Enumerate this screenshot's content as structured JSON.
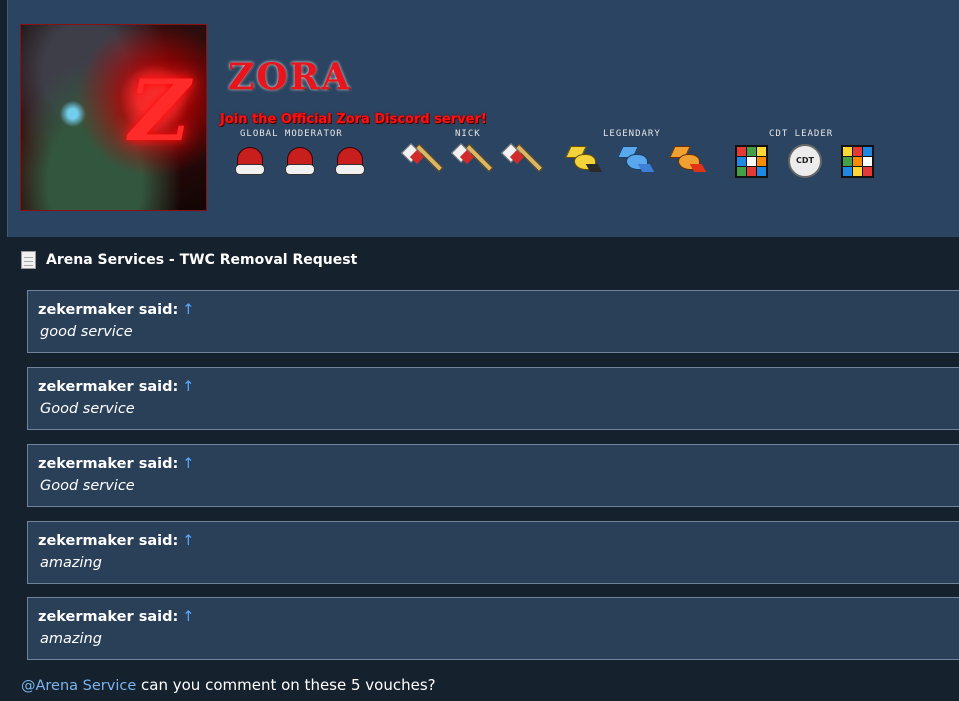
{
  "signature": {
    "logo_text": "ZORA",
    "discord_text": "Join the Official Zora Discord server!",
    "avatar_letter": "Z",
    "ranks": [
      {
        "label": "GLOBAL MODERATOR",
        "icon": "santa-hat-icon"
      },
      {
        "label": "NICK",
        "icon": "spear-icon"
      },
      {
        "label": "LEGENDARY",
        "icon": "legendary-bird-icon"
      },
      {
        "label": "CDT LEADER",
        "icon": "rubiks-cube-icon"
      }
    ],
    "cdt_badge_text": "CDT"
  },
  "thread": {
    "title": "Arena Services - TWC Removal Request"
  },
  "quotes": [
    {
      "author": "zekermaker said:",
      "arrow": "↑",
      "text": "good service"
    },
    {
      "author": "zekermaker said:",
      "arrow": "↑",
      "text": "Good service"
    },
    {
      "author": "zekermaker said:",
      "arrow": "↑",
      "text": "Good service"
    },
    {
      "author": "zekermaker said:",
      "arrow": "↑",
      "text": "amazing"
    },
    {
      "author": "zekermaker said:",
      "arrow": "↑",
      "text": "amazing"
    }
  ],
  "reply": {
    "mention": "@Arena Service",
    "text": " can you comment on these 5 vouches?"
  },
  "colors": {
    "banner_bg": "#2a4461",
    "page_bg": "#16212e",
    "quote_bg": "#2a4059",
    "quote_border": "#6f8399",
    "link": "#7ab3ee",
    "arrow": "#5aa8ff",
    "logo_red": "#e8141e"
  }
}
